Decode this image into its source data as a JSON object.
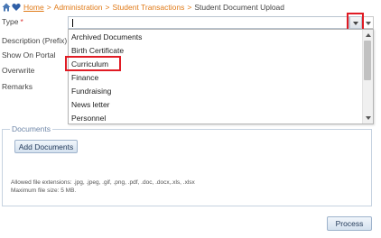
{
  "breadcrumb": {
    "home": "Home",
    "items": [
      "Administration",
      "Student Transactions"
    ],
    "current": "Student Document Upload",
    "separator": ">"
  },
  "form": {
    "type_label": "Type",
    "required_mark": "*",
    "description_label": "Description (Prefix)",
    "show_on_portal_label": "Show On Portal",
    "overwrite_label": "Overwrite",
    "remarks_label": "Remarks"
  },
  "type_dropdown": {
    "value": "",
    "options": [
      "Archived Documents",
      "Birth Certificate",
      "Curriculum",
      "Finance",
      "Fundraising",
      "News letter",
      "Personnel"
    ],
    "highlighted_option": "Curriculum"
  },
  "documents": {
    "legend": "Documents",
    "add_button": "Add Documents",
    "allowed_extensions": "Allowed file extensions: .jpg, .jpeg, .gif, .png, .pdf, .doc, .docx,.xls, .xlsx",
    "max_size": "Maximum file size: 5 MB."
  },
  "actions": {
    "process": "Process"
  },
  "colors": {
    "link": "#e07a17",
    "highlight": "#e01b24",
    "legend": "#6e86a8"
  },
  "icons": [
    "home-icon",
    "favorite-heart-icon",
    "dropdown-arrow-icon",
    "scroll-up-icon",
    "scroll-down-icon"
  ]
}
